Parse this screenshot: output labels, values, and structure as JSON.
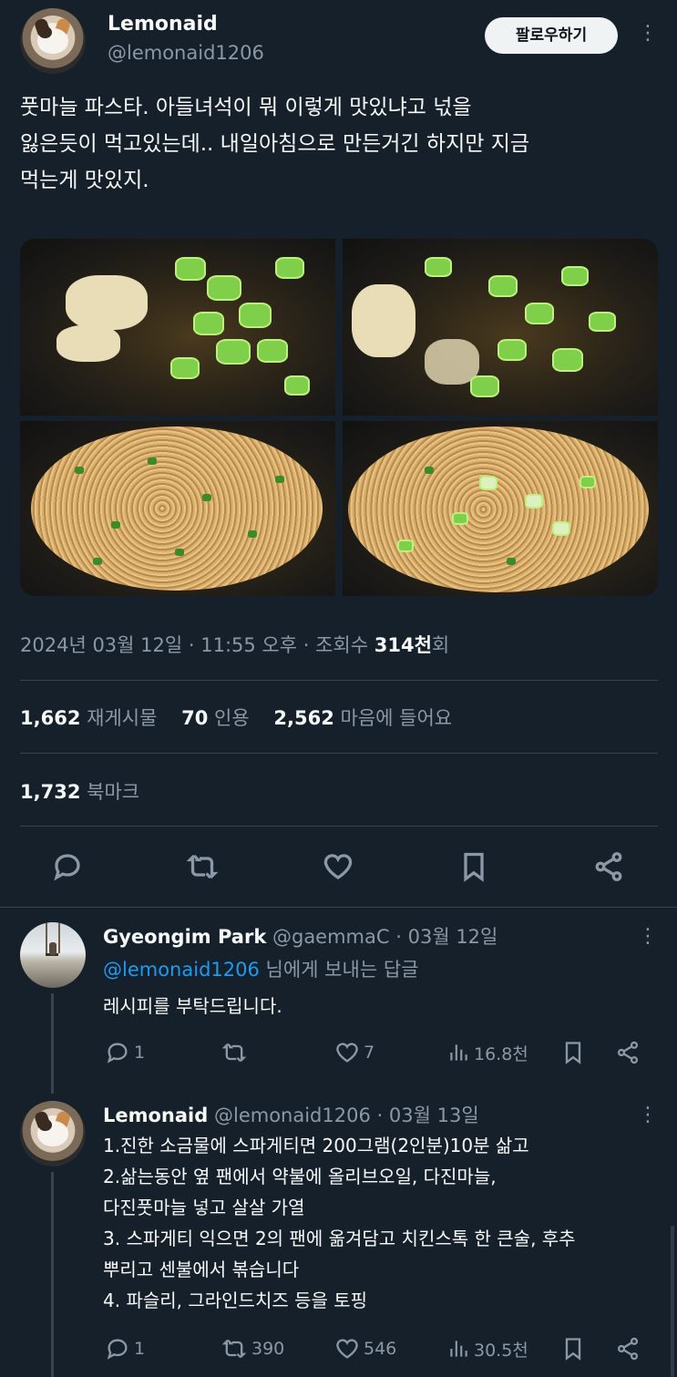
{
  "tweet": {
    "name": "Lemonaid",
    "handle": "@lemonaid1206",
    "follow_label": "팔로우하기",
    "more": "⋮",
    "text_lines": [
      "풋마늘 파스타. 아들녀석이 뭐 이렇게 맛있냐고 넋을",
      "잃은듯이 먹고있는데.. 내일아침으로 만든거긴 하지만 지금",
      "먹는게 맛있지."
    ],
    "meta_date": "2024년 03월 12일 · 11:55 오후 · 조회수",
    "meta_views": "314천",
    "meta_views_suffix": "회",
    "stats": {
      "retweets_num": "1,662",
      "retweets_label": "재게시물",
      "quotes_num": "70",
      "quotes_label": "인용",
      "likes_num": "2,562",
      "likes_label": "마음에 들어요",
      "bookmarks_num": "1,732",
      "bookmarks_label": "북마크"
    }
  },
  "replies": [
    {
      "name": "Gyeongim Park",
      "handle": "@gaemmaC",
      "date": "· 03월 12일",
      "reply_to_handle": "@lemonaid1206",
      "reply_to_suffix": "님에게 보내는 답글",
      "text_lines": [
        "레시피를 부탁드립니다."
      ],
      "reply_count": "1",
      "retweet_count": "",
      "like_count": "7",
      "views": "16.8천"
    },
    {
      "name": "Lemonaid",
      "handle": "@lemonaid1206",
      "date": "· 03월 13일",
      "text_lines": [
        "1.진한 소금물에 스파게티면 200그램(2인분)10분 삶고",
        "2.삶는동안 옆 팬에서 약불에 올리브오일, 다진마늘,",
        "다진풋마늘 넣고 살살 가열",
        "3. 스파게티 익으면 2의 팬에 옮겨담고 치킨스톡 한 큰술, 후추",
        "뿌리고 센불에서 볶습니다",
        "4. 파슬리, 그라인드치즈 등을 토핑"
      ],
      "reply_count": "1",
      "retweet_count": "390",
      "like_count": "546",
      "views": "30.5천"
    }
  ],
  "colors": {
    "background": "#15202b",
    "text": "#f7f9f9",
    "muted": "#8b98a5",
    "link": "#1d9bf0",
    "divider": "#38444d"
  },
  "icons": [
    "reply-icon",
    "retweet-icon",
    "like-icon",
    "bookmark-icon",
    "share-icon",
    "views-icon",
    "more-icon"
  ]
}
